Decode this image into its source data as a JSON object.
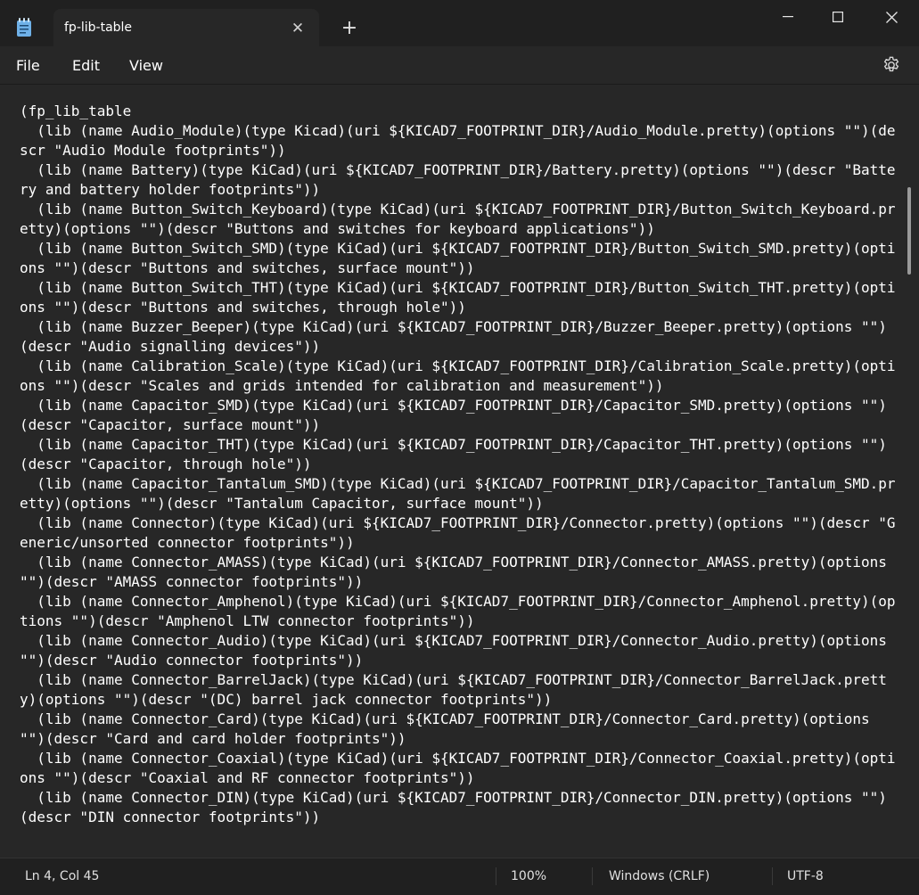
{
  "window": {
    "tab_title": "fp-lib-table",
    "minimize_label": "—",
    "maximize_label": "☐",
    "close_label": "✕",
    "new_tab_label": "+",
    "tab_close_label": "✕"
  },
  "menu": {
    "file": "File",
    "edit": "Edit",
    "view": "View",
    "settings_icon": "gear-icon"
  },
  "editor": {
    "content": "(fp_lib_table\n  (lib (name Audio_Module)(type Kicad)(uri ${KICAD7_FOOTPRINT_DIR}/Audio_Module.pretty)(options \"\")(descr \"Audio Module footprints\"))\n  (lib (name Battery)(type KiCad)(uri ${KICAD7_FOOTPRINT_DIR}/Battery.pretty)(options \"\")(descr \"Battery and battery holder footprints\"))\n  (lib (name Button_Switch_Keyboard)(type KiCad)(uri ${KICAD7_FOOTPRINT_DIR}/Button_Switch_Keyboard.pretty)(options \"\")(descr \"Buttons and switches for keyboard applications\"))\n  (lib (name Button_Switch_SMD)(type KiCad)(uri ${KICAD7_FOOTPRINT_DIR}/Button_Switch_SMD.pretty)(options \"\")(descr \"Buttons and switches, surface mount\"))\n  (lib (name Button_Switch_THT)(type KiCad)(uri ${KICAD7_FOOTPRINT_DIR}/Button_Switch_THT.pretty)(options \"\")(descr \"Buttons and switches, through hole\"))\n  (lib (name Buzzer_Beeper)(type KiCad)(uri ${KICAD7_FOOTPRINT_DIR}/Buzzer_Beeper.pretty)(options \"\")(descr \"Audio signalling devices\"))\n  (lib (name Calibration_Scale)(type KiCad)(uri ${KICAD7_FOOTPRINT_DIR}/Calibration_Scale.pretty)(options \"\")(descr \"Scales and grids intended for calibration and measurement\"))\n  (lib (name Capacitor_SMD)(type KiCad)(uri ${KICAD7_FOOTPRINT_DIR}/Capacitor_SMD.pretty)(options \"\")(descr \"Capacitor, surface mount\"))\n  (lib (name Capacitor_THT)(type KiCad)(uri ${KICAD7_FOOTPRINT_DIR}/Capacitor_THT.pretty)(options \"\")(descr \"Capacitor, through hole\"))\n  (lib (name Capacitor_Tantalum_SMD)(type KiCad)(uri ${KICAD7_FOOTPRINT_DIR}/Capacitor_Tantalum_SMD.pretty)(options \"\")(descr \"Tantalum Capacitor, surface mount\"))\n  (lib (name Connector)(type KiCad)(uri ${KICAD7_FOOTPRINT_DIR}/Connector.pretty)(options \"\")(descr \"Generic/unsorted connector footprints\"))\n  (lib (name Connector_AMASS)(type KiCad)(uri ${KICAD7_FOOTPRINT_DIR}/Connector_AMASS.pretty)(options \"\")(descr \"AMASS connector footprints\"))\n  (lib (name Connector_Amphenol)(type KiCad)(uri ${KICAD7_FOOTPRINT_DIR}/Connector_Amphenol.pretty)(options \"\")(descr \"Amphenol LTW connector footprints\"))\n  (lib (name Connector_Audio)(type KiCad)(uri ${KICAD7_FOOTPRINT_DIR}/Connector_Audio.pretty)(options \"\")(descr \"Audio connector footprints\"))\n  (lib (name Connector_BarrelJack)(type KiCad)(uri ${KICAD7_FOOTPRINT_DIR}/Connector_BarrelJack.pretty)(options \"\")(descr \"(DC) barrel jack connector footprints\"))\n  (lib (name Connector_Card)(type KiCad)(uri ${KICAD7_FOOTPRINT_DIR}/Connector_Card.pretty)(options \"\")(descr \"Card and card holder footprints\"))\n  (lib (name Connector_Coaxial)(type KiCad)(uri ${KICAD7_FOOTPRINT_DIR}/Connector_Coaxial.pretty)(options \"\")(descr \"Coaxial and RF connector footprints\"))\n  (lib (name Connector_DIN)(type KiCad)(uri ${KICAD7_FOOTPRINT_DIR}/Connector_DIN.pretty)(options \"\")(descr \"DIN connector footprints\"))"
  },
  "status": {
    "position": "Ln 4, Col 45",
    "zoom": "100%",
    "line_ending": "Windows (CRLF)",
    "encoding": "UTF-8"
  }
}
